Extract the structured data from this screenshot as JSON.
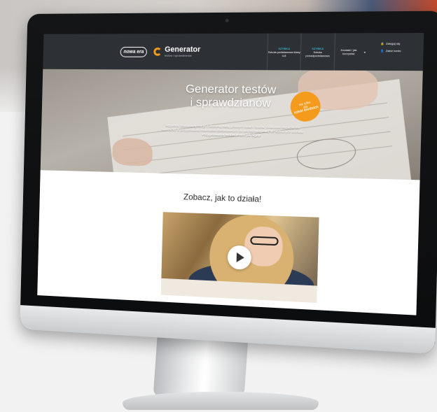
{
  "brand": {
    "partner_logo": "nowa era",
    "app_name": "Generator",
    "app_subtitle": "testów i sprawdzianów"
  },
  "nav": {
    "items": [
      {
        "tag": "SZYBKA",
        "label": "Szkoła podstawowa klasy 4-8"
      },
      {
        "tag": "SZYBKA",
        "label": "Szkoła ponadpodstawowa"
      }
    ],
    "dropdown_label": "Kontakt / jak korzystać",
    "login_label": "Zaloguj się",
    "register_label": "Załóż konto"
  },
  "hero": {
    "title_line1": "Generator testów",
    "title_line2": "i sprawdzianów",
    "description": "Wygodna, intuicyjna aplikacja z obszerną bazą gotowych zadań i testów. Doskonałe wsparcie dla nauczycieli w przygotowaniu materiałów dostosowanych do potrzeb całej klasy lub wybranych uczniów.",
    "description_emphasis": "Przygotowanie testów prosto jak nigdy!",
    "badge_line1": "nie tylko",
    "badge_line2": "dla",
    "badge_line3": "szkół średnich"
  },
  "video_section": {
    "title": "Zobacz, jak to działa!"
  },
  "colors": {
    "accent": "#f49a1c",
    "topbar": "#2d3136",
    "nav_tag": "#34b3c7"
  }
}
